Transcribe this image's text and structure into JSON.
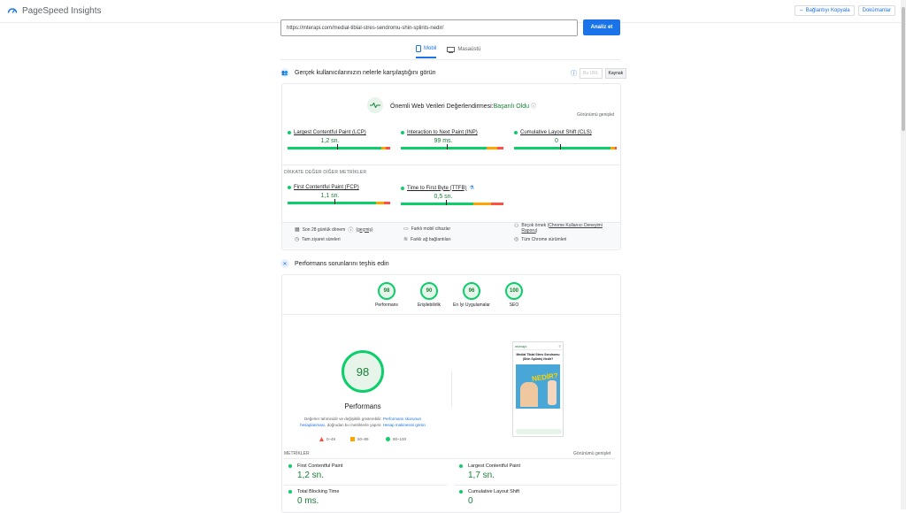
{
  "header": {
    "app_title": "PageSpeed Insights",
    "copy_link_label": "Bağlantıyı Kopyala",
    "docs_label": "Dokümanlar"
  },
  "search": {
    "url_value": "https://mterapi.com/medial-tibial-stres-sendromu-shin-splints-nedir/",
    "analyze_label": "Analiz et"
  },
  "device_tabs": [
    {
      "label": "Mobil",
      "active": true,
      "icon": "mobile-icon"
    },
    {
      "label": "Masaüstü",
      "active": false,
      "icon": "desktop-icon"
    }
  ],
  "real_users": {
    "heading": "Gerçek kullanıcılarınızın nelerle karşılaştığını görün",
    "toggle_off": "Bu URL",
    "toggle_on": "Kaynak",
    "cwv_title": "Önemli Web Verileri Değerlendirmesi:",
    "cwv_status": "Başarılı Oldu",
    "expand_view": "Görünümü genişlet",
    "metrics": [
      {
        "label": "Largest Contentful Paint (LCP)",
        "value": "1,2 sn.",
        "good_pct": 91,
        "mark_pct": 48
      },
      {
        "label": "Interaction to Next Paint (INP)",
        "value": "99 ms.",
        "good_pct": 84,
        "mark_pct": 45
      },
      {
        "label": "Cumulative Layout Shift (CLS)",
        "value": "0",
        "good_pct": 94,
        "mark_pct": 45
      }
    ],
    "other_heading": "DİKKATE DEĞER DİĞER METRİKLER",
    "other_metrics": [
      {
        "label": "First Contentful Paint (FCP)",
        "value": "1,1 sn.",
        "good_pct": 86,
        "mark_pct": 46
      },
      {
        "label": "Time to First Byte (TTFB)",
        "value": "0,5 sn.",
        "good_pct": 71,
        "mark_pct": 44
      }
    ],
    "info": {
      "period": "Son 28 günlük dönem",
      "period_link": "(geçmiş)",
      "devices": "Farklı mobil cihazlar",
      "source_prefix": "Birçok örnek",
      "source_link": "Chrome Kullanıcı Deneyimi Raporu",
      "visits": "Tam ziyaret süreleri",
      "network": "Farklı ağ bağlantıları",
      "versions": "Tüm Chrome sürümleri"
    }
  },
  "diagnose": {
    "heading": "Performans sorunlarını teşhis edin",
    "scores": [
      {
        "value": "98",
        "label": "Performans"
      },
      {
        "value": "90",
        "label": "Erişilebilirlik"
      },
      {
        "value": "96",
        "label": "En İyi Uygulamalar"
      },
      {
        "value": "100",
        "label": "SEO"
      }
    ],
    "main_score": "98",
    "main_label": "Performans",
    "note_1": "Değerler tahminidir ve değişiklik gösterebilir.",
    "note_link_1": "Performans skorunun hesaplanması",
    "note_2": ", doğrudan bu metriklerle yapılır.",
    "note_link_2": "Hesap makinesini görün",
    "legend": [
      {
        "range": "0–49",
        "color": "#ff4e42"
      },
      {
        "range": "50–89",
        "color": "#ffa400"
      },
      {
        "range": "90–100",
        "color": "#0cce6b"
      }
    ],
    "preview": {
      "logo": "mterapi",
      "title": "Medial Tibial Stres Sendromu (Shin Splints) Nedir?",
      "hero_word": "NEDİR?"
    }
  },
  "lab_metrics": {
    "heading": "METRİKLER",
    "expand_view": "Görünümü genişlet",
    "items": [
      {
        "label": "First Contentful Paint",
        "value": "1,2 sn."
      },
      {
        "label": "Largest Contentful Paint",
        "value": "1,7 sn."
      },
      {
        "label": "Total Blocking Time",
        "value": "0 ms."
      },
      {
        "label": "Cumulative Layout Shift",
        "value": "0"
      }
    ]
  }
}
